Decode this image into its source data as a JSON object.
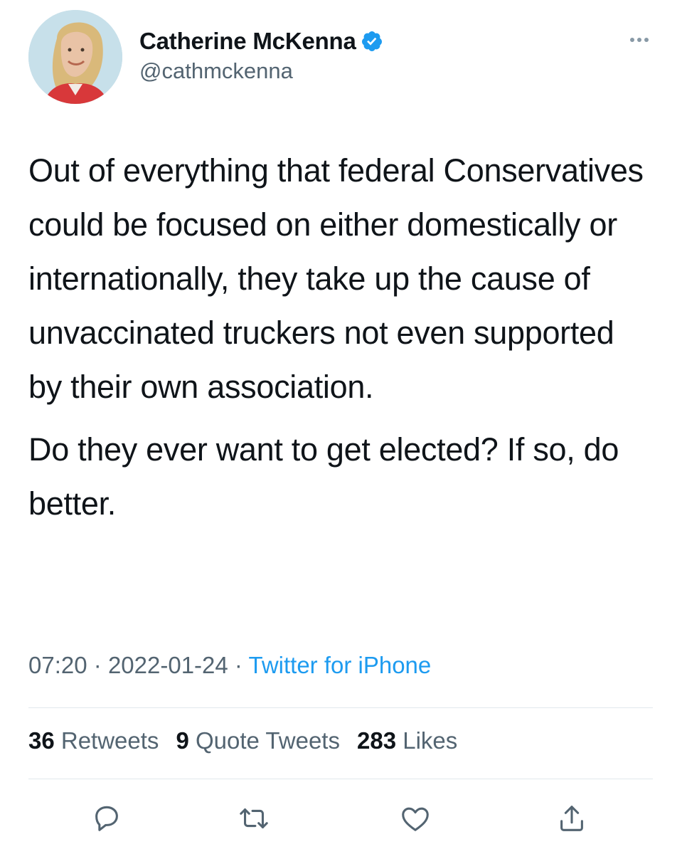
{
  "author": {
    "display_name": "Catherine McKenna",
    "handle": "@cathmckenna",
    "verified": true,
    "avatar_icon": "profile-photo"
  },
  "tweet": {
    "paragraphs": [
      "Out of everything that federal Conservatives could be focused on either domestically or internationally, they take up the cause of unvaccinated truckers not even supported by their own association.",
      "Do they ever want to get elected? If so, do better."
    ],
    "time": "07:20",
    "separator": "·",
    "date": "2022-01-24",
    "source": "Twitter for iPhone"
  },
  "stats": {
    "retweets_count": "36",
    "retweets_label": "Retweets",
    "quotes_count": "9",
    "quotes_label": "Quote Tweets",
    "likes_count": "283",
    "likes_label": "Likes"
  },
  "actions": [
    {
      "name": "reply",
      "icon": "reply-icon"
    },
    {
      "name": "retweet",
      "icon": "retweet-icon"
    },
    {
      "name": "like",
      "icon": "heart-icon"
    },
    {
      "name": "share",
      "icon": "share-icon"
    }
  ],
  "colors": {
    "text_primary": "#0f1419",
    "text_secondary": "#536471",
    "accent": "#1d9bf0",
    "divider": "#e1e8ed",
    "icon": "#536471"
  }
}
